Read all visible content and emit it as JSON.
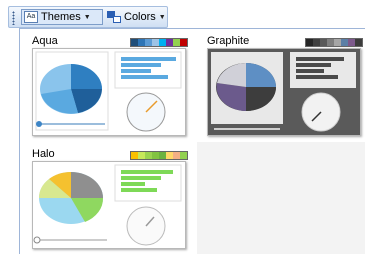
{
  "toolbar": {
    "themes_label": "Themes",
    "colors_label": "Colors",
    "themes_icon": "themes-icon",
    "colors_icon": "colors-icon",
    "dropdown_icon": "chevron-down-icon"
  },
  "themes": [
    {
      "name": "Aqua",
      "selected": false,
      "swatches": [
        "#1f4e79",
        "#2e75b6",
        "#5b9bd5",
        "#9dc3e6",
        "#00b0f0",
        "#7030a0",
        "#92d050",
        "#c00000"
      ],
      "background": "#ffffff",
      "accent": "#4a90d9"
    },
    {
      "name": "Graphite",
      "selected": true,
      "swatches": [
        "#262626",
        "#404040",
        "#595959",
        "#7f7f7f",
        "#a6a6a6",
        "#5b7fa6",
        "#7d5a8c",
        "#3c3c3c"
      ],
      "background": "#5a5a5a",
      "accent": "#5e8fc4"
    },
    {
      "name": "Halo",
      "selected": false,
      "swatches": [
        "#fac000",
        "#c6e85a",
        "#9bd34f",
        "#82c341",
        "#6cb33f",
        "#ffd966",
        "#f4b084",
        "#92d050"
      ],
      "background": "#ffffff",
      "accent": "#7ed957"
    }
  ]
}
